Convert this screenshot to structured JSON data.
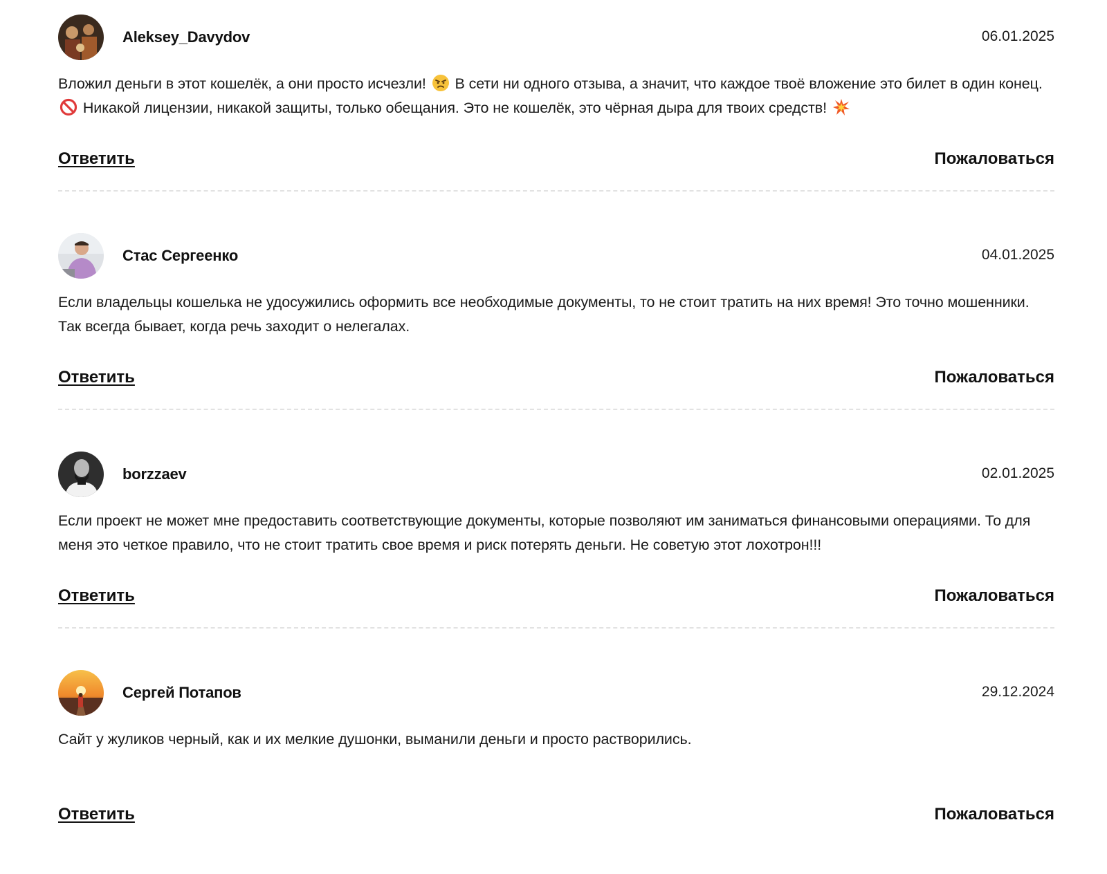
{
  "comments": [
    {
      "author": "Aleksey_Davydov",
      "date": "06.01.2025",
      "text_part1": "Вложил деньги в этот кошелёк, а они просто исчезли!",
      "text_part2": "В сети ни одного отзыва, а значит, что каждое твоё вложение это билет в один конец.",
      "text_part3": "Никакой лицензии, никакой защиты, только обещания. Это не кошелёк, это чёрная дыра для твоих средств!",
      "emojis": [
        "angry-face-icon",
        "prohibited-icon",
        "collision-icon"
      ],
      "reply_label": "Ответить",
      "report_label": "Пожаловаться"
    },
    {
      "author": "Стас Сергеенко",
      "date": "04.01.2025",
      "text": "Если владельцы кошелька не удосужились оформить все необходимые документы, то не стоит тратить на них время! Это точно мошенники. Так всегда бывает, когда речь заходит о нелегалах.",
      "reply_label": "Ответить",
      "report_label": "Пожаловаться"
    },
    {
      "author": "borzzaev",
      "date": "02.01.2025",
      "text": "Если проект не может мне предоставить соответствующие документы, которые позволяют им заниматься финансовыми операциями. То для меня это четкое правило, что не стоит тратить свое время и риск потерять деньги. Не советую этот лохотрон!!!",
      "reply_label": "Ответить",
      "report_label": "Пожаловаться"
    },
    {
      "author": "Сергей Потапов",
      "date": "29.12.2024",
      "text": "Сайт у жуликов черный, как и их мелкие душонки, выманили деньги и просто растворились.",
      "reply_label": "Ответить",
      "report_label": "Пожаловаться"
    }
  ]
}
